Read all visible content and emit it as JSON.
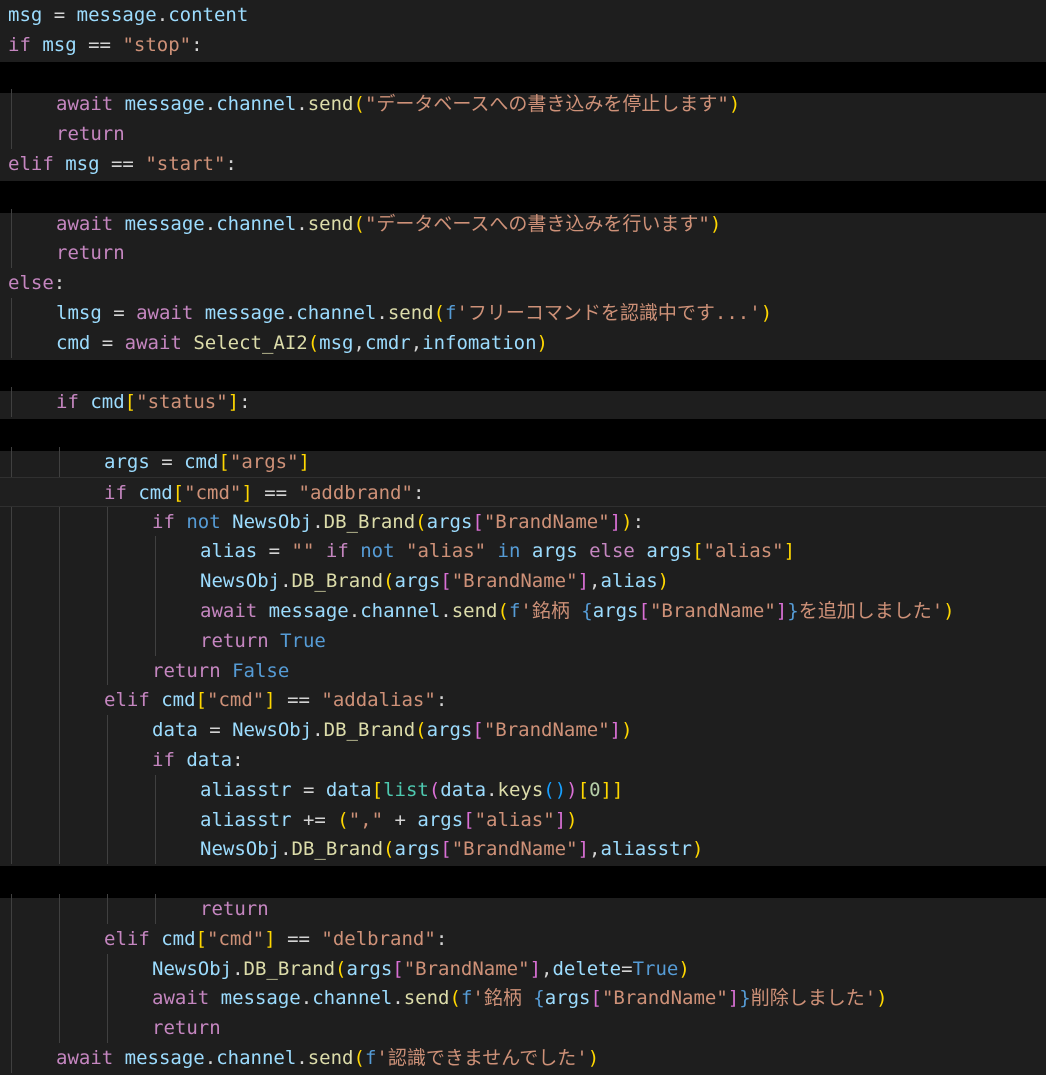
{
  "colors": {
    "background": "#1e1e1e",
    "redaction": "#000000",
    "indent_guide": "#404040",
    "control_keyword": "#c586c0",
    "keyword": "#569cd6",
    "variable": "#9cdcfe",
    "function": "#dcdcaa",
    "string": "#ce9178",
    "operator": "#d4d4d4",
    "number": "#b5cea8",
    "class": "#4ec9b0",
    "bracket_level1": "#ffd700",
    "bracket_level2": "#da70d6",
    "bracket_level3": "#179fff"
  },
  "redacted_line_numbers": [
    3,
    6,
    12,
    14,
    29
  ],
  "code_lines": [
    {
      "indent": 0,
      "tokens": [
        [
          "var",
          "msg"
        ],
        [
          "op",
          " = "
        ],
        [
          "var",
          "message"
        ],
        [
          "op",
          "."
        ],
        [
          "var",
          "content"
        ]
      ]
    },
    {
      "indent": 0,
      "tokens": [
        [
          "ctrl",
          "if"
        ],
        [
          "op",
          " "
        ],
        [
          "var",
          "msg"
        ],
        [
          "op",
          " == "
        ],
        [
          "str",
          "\"stop\""
        ],
        [
          "op",
          ":"
        ]
      ]
    },
    null,
    {
      "indent": 1,
      "tokens": [
        [
          "ctrl",
          "await"
        ],
        [
          "op",
          " "
        ],
        [
          "var",
          "message"
        ],
        [
          "op",
          "."
        ],
        [
          "var",
          "channel"
        ],
        [
          "op",
          "."
        ],
        [
          "fn",
          "send"
        ],
        [
          "b1",
          "("
        ],
        [
          "str",
          "\"データベースへの書き込みを停止します\""
        ],
        [
          "b1",
          ")"
        ]
      ]
    },
    {
      "indent": 1,
      "tokens": [
        [
          "ctrl",
          "return"
        ]
      ]
    },
    {
      "indent": 0,
      "tokens": [
        [
          "ctrl",
          "elif"
        ],
        [
          "op",
          " "
        ],
        [
          "var",
          "msg"
        ],
        [
          "op",
          " == "
        ],
        [
          "str",
          "\"start\""
        ],
        [
          "op",
          ":"
        ]
      ]
    },
    null,
    {
      "indent": 1,
      "tokens": [
        [
          "ctrl",
          "await"
        ],
        [
          "op",
          " "
        ],
        [
          "var",
          "message"
        ],
        [
          "op",
          "."
        ],
        [
          "var",
          "channel"
        ],
        [
          "op",
          "."
        ],
        [
          "fn",
          "send"
        ],
        [
          "b1",
          "("
        ],
        [
          "str",
          "\"データベースへの書き込みを行います\""
        ],
        [
          "b1",
          ")"
        ]
      ]
    },
    {
      "indent": 1,
      "tokens": [
        [
          "ctrl",
          "return"
        ]
      ]
    },
    {
      "indent": 0,
      "tokens": [
        [
          "ctrl",
          "else"
        ],
        [
          "op",
          ":"
        ]
      ]
    },
    {
      "indent": 1,
      "tokens": [
        [
          "var",
          "lmsg"
        ],
        [
          "op",
          " = "
        ],
        [
          "ctrl",
          "await"
        ],
        [
          "op",
          " "
        ],
        [
          "var",
          "message"
        ],
        [
          "op",
          "."
        ],
        [
          "var",
          "channel"
        ],
        [
          "op",
          "."
        ],
        [
          "fn",
          "send"
        ],
        [
          "b1",
          "("
        ],
        [
          "kw",
          "f"
        ],
        [
          "str",
          "'フリーコマンドを認識中です...'"
        ],
        [
          "b1",
          ")"
        ]
      ]
    },
    {
      "indent": 1,
      "tokens": [
        [
          "var",
          "cmd"
        ],
        [
          "op",
          " = "
        ],
        [
          "ctrl",
          "await"
        ],
        [
          "op",
          " "
        ],
        [
          "fn",
          "Select_AI2"
        ],
        [
          "b1",
          "("
        ],
        [
          "var",
          "msg"
        ],
        [
          "op",
          ","
        ],
        [
          "var",
          "cmdr"
        ],
        [
          "op",
          ","
        ],
        [
          "var",
          "infomation"
        ],
        [
          "b1",
          ")"
        ]
      ]
    },
    null,
    {
      "indent": 1,
      "tokens": [
        [
          "ctrl",
          "if"
        ],
        [
          "op",
          " "
        ],
        [
          "var",
          "cmd"
        ],
        [
          "b1",
          "["
        ],
        [
          "str",
          "\"status\""
        ],
        [
          "b1",
          "]"
        ],
        [
          "op",
          ":"
        ]
      ]
    },
    null,
    {
      "indent": 2,
      "tokens": [
        [
          "var",
          "args"
        ],
        [
          "op",
          " = "
        ],
        [
          "var",
          "cmd"
        ],
        [
          "b1",
          "["
        ],
        [
          "str",
          "\"args\""
        ],
        [
          "b1",
          "]"
        ]
      ]
    },
    {
      "indent": 2,
      "current": true,
      "tokens": [
        [
          "ctrl",
          "if"
        ],
        [
          "op",
          " "
        ],
        [
          "var",
          "cmd"
        ],
        [
          "b1",
          "["
        ],
        [
          "str",
          "\"cmd\""
        ],
        [
          "b1",
          "]"
        ],
        [
          "op",
          " == "
        ],
        [
          "str",
          "\"addbrand\""
        ],
        [
          "op",
          ":"
        ]
      ]
    },
    {
      "indent": 3,
      "tokens": [
        [
          "ctrl",
          "if"
        ],
        [
          "op",
          " "
        ],
        [
          "kw",
          "not"
        ],
        [
          "op",
          " "
        ],
        [
          "var",
          "NewsObj"
        ],
        [
          "op",
          "."
        ],
        [
          "fn",
          "DB_Brand"
        ],
        [
          "b1",
          "("
        ],
        [
          "var",
          "args"
        ],
        [
          "b2",
          "["
        ],
        [
          "str",
          "\"BrandName\""
        ],
        [
          "b2",
          "]"
        ],
        [
          "b1",
          ")"
        ],
        [
          "op",
          ":"
        ]
      ]
    },
    {
      "indent": 4,
      "tokens": [
        [
          "var",
          "alias"
        ],
        [
          "op",
          " = "
        ],
        [
          "str",
          "\"\""
        ],
        [
          "op",
          " "
        ],
        [
          "ctrl",
          "if"
        ],
        [
          "op",
          " "
        ],
        [
          "kw",
          "not"
        ],
        [
          "op",
          " "
        ],
        [
          "str",
          "\"alias\""
        ],
        [
          "op",
          " "
        ],
        [
          "kw",
          "in"
        ],
        [
          "op",
          " "
        ],
        [
          "var",
          "args"
        ],
        [
          "op",
          " "
        ],
        [
          "ctrl",
          "else"
        ],
        [
          "op",
          " "
        ],
        [
          "var",
          "args"
        ],
        [
          "b1",
          "["
        ],
        [
          "str",
          "\"alias\""
        ],
        [
          "b1",
          "]"
        ]
      ]
    },
    {
      "indent": 4,
      "tokens": [
        [
          "var",
          "NewsObj"
        ],
        [
          "op",
          "."
        ],
        [
          "fn",
          "DB_Brand"
        ],
        [
          "b1",
          "("
        ],
        [
          "var",
          "args"
        ],
        [
          "b2",
          "["
        ],
        [
          "str",
          "\"BrandName\""
        ],
        [
          "b2",
          "]"
        ],
        [
          "op",
          ","
        ],
        [
          "var",
          "alias"
        ],
        [
          "b1",
          ")"
        ]
      ]
    },
    {
      "indent": 4,
      "tokens": [
        [
          "ctrl",
          "await"
        ],
        [
          "op",
          " "
        ],
        [
          "var",
          "message"
        ],
        [
          "op",
          "."
        ],
        [
          "var",
          "channel"
        ],
        [
          "op",
          "."
        ],
        [
          "fn",
          "send"
        ],
        [
          "b1",
          "("
        ],
        [
          "kw",
          "f"
        ],
        [
          "str",
          "'銘柄 "
        ],
        [
          "kw",
          "{"
        ],
        [
          "var",
          "args"
        ],
        [
          "b2",
          "["
        ],
        [
          "str",
          "\"BrandName\""
        ],
        [
          "b2",
          "]"
        ],
        [
          "kw",
          "}"
        ],
        [
          "str",
          "を追加しました'"
        ],
        [
          "b1",
          ")"
        ]
      ]
    },
    {
      "indent": 4,
      "tokens": [
        [
          "ctrl",
          "return"
        ],
        [
          "op",
          " "
        ],
        [
          "kw",
          "True"
        ]
      ]
    },
    {
      "indent": 3,
      "tokens": [
        [
          "ctrl",
          "return"
        ],
        [
          "op",
          " "
        ],
        [
          "kw",
          "False"
        ]
      ]
    },
    {
      "indent": 2,
      "tokens": [
        [
          "ctrl",
          "elif"
        ],
        [
          "op",
          " "
        ],
        [
          "var",
          "cmd"
        ],
        [
          "b1",
          "["
        ],
        [
          "str",
          "\"cmd\""
        ],
        [
          "b1",
          "]"
        ],
        [
          "op",
          " == "
        ],
        [
          "str",
          "\"addalias\""
        ],
        [
          "op",
          ":"
        ]
      ]
    },
    {
      "indent": 3,
      "tokens": [
        [
          "var",
          "data"
        ],
        [
          "op",
          " = "
        ],
        [
          "var",
          "NewsObj"
        ],
        [
          "op",
          "."
        ],
        [
          "fn",
          "DB_Brand"
        ],
        [
          "b1",
          "("
        ],
        [
          "var",
          "args"
        ],
        [
          "b2",
          "["
        ],
        [
          "str",
          "\"BrandName\""
        ],
        [
          "b2",
          "]"
        ],
        [
          "b1",
          ")"
        ]
      ]
    },
    {
      "indent": 3,
      "tokens": [
        [
          "ctrl",
          "if"
        ],
        [
          "op",
          " "
        ],
        [
          "var",
          "data"
        ],
        [
          "op",
          ":"
        ]
      ]
    },
    {
      "indent": 4,
      "tokens": [
        [
          "var",
          "aliasstr"
        ],
        [
          "op",
          " = "
        ],
        [
          "var",
          "data"
        ],
        [
          "b1",
          "["
        ],
        [
          "cls",
          "list"
        ],
        [
          "b2",
          "("
        ],
        [
          "var",
          "data"
        ],
        [
          "op",
          "."
        ],
        [
          "fn",
          "keys"
        ],
        [
          "b3",
          "()"
        ],
        [
          "b2",
          ")"
        ],
        [
          "b1",
          "["
        ],
        [
          "num",
          "0"
        ],
        [
          "b1",
          "]]"
        ]
      ]
    },
    {
      "indent": 4,
      "tokens": [
        [
          "var",
          "aliasstr"
        ],
        [
          "op",
          " += "
        ],
        [
          "b1",
          "("
        ],
        [
          "str",
          "\",\""
        ],
        [
          "op",
          " + "
        ],
        [
          "var",
          "args"
        ],
        [
          "b2",
          "["
        ],
        [
          "str",
          "\"alias\""
        ],
        [
          "b2",
          "]"
        ],
        [
          "b1",
          ")"
        ]
      ]
    },
    {
      "indent": 4,
      "tokens": [
        [
          "var",
          "NewsObj"
        ],
        [
          "op",
          "."
        ],
        [
          "fn",
          "DB_Brand"
        ],
        [
          "b1",
          "("
        ],
        [
          "var",
          "args"
        ],
        [
          "b2",
          "["
        ],
        [
          "str",
          "\"BrandName\""
        ],
        [
          "b2",
          "]"
        ],
        [
          "op",
          ","
        ],
        [
          "var",
          "aliasstr"
        ],
        [
          "b1",
          ")"
        ]
      ]
    },
    null,
    {
      "indent": 4,
      "tokens": [
        [
          "ctrl",
          "return"
        ]
      ]
    },
    {
      "indent": 2,
      "tokens": [
        [
          "ctrl",
          "elif"
        ],
        [
          "op",
          " "
        ],
        [
          "var",
          "cmd"
        ],
        [
          "b1",
          "["
        ],
        [
          "str",
          "\"cmd\""
        ],
        [
          "b1",
          "]"
        ],
        [
          "op",
          " == "
        ],
        [
          "str",
          "\"delbrand\""
        ],
        [
          "op",
          ":"
        ]
      ]
    },
    {
      "indent": 3,
      "tokens": [
        [
          "var",
          "NewsObj"
        ],
        [
          "op",
          "."
        ],
        [
          "fn",
          "DB_Brand"
        ],
        [
          "b1",
          "("
        ],
        [
          "var",
          "args"
        ],
        [
          "b2",
          "["
        ],
        [
          "str",
          "\"BrandName\""
        ],
        [
          "b2",
          "]"
        ],
        [
          "op",
          ","
        ],
        [
          "var",
          "delete"
        ],
        [
          "op",
          "="
        ],
        [
          "kw",
          "True"
        ],
        [
          "b1",
          ")"
        ]
      ]
    },
    {
      "indent": 3,
      "tokens": [
        [
          "ctrl",
          "await"
        ],
        [
          "op",
          " "
        ],
        [
          "var",
          "message"
        ],
        [
          "op",
          "."
        ],
        [
          "var",
          "channel"
        ],
        [
          "op",
          "."
        ],
        [
          "fn",
          "send"
        ],
        [
          "b1",
          "("
        ],
        [
          "kw",
          "f"
        ],
        [
          "str",
          "'銘柄 "
        ],
        [
          "kw",
          "{"
        ],
        [
          "var",
          "args"
        ],
        [
          "b2",
          "["
        ],
        [
          "str",
          "\"BrandName\""
        ],
        [
          "b2",
          "]"
        ],
        [
          "kw",
          "}"
        ],
        [
          "str",
          "削除しました'"
        ],
        [
          "b1",
          ")"
        ]
      ]
    },
    {
      "indent": 3,
      "tokens": [
        [
          "ctrl",
          "return"
        ]
      ]
    },
    {
      "indent": 1,
      "tokens": [
        [
          "ctrl",
          "await"
        ],
        [
          "op",
          " "
        ],
        [
          "var",
          "message"
        ],
        [
          "op",
          "."
        ],
        [
          "var",
          "channel"
        ],
        [
          "op",
          "."
        ],
        [
          "fn",
          "send"
        ],
        [
          "b1",
          "("
        ],
        [
          "kw",
          "f"
        ],
        [
          "str",
          "'認識できませんでした'"
        ],
        [
          "b1",
          ")"
        ]
      ]
    }
  ]
}
